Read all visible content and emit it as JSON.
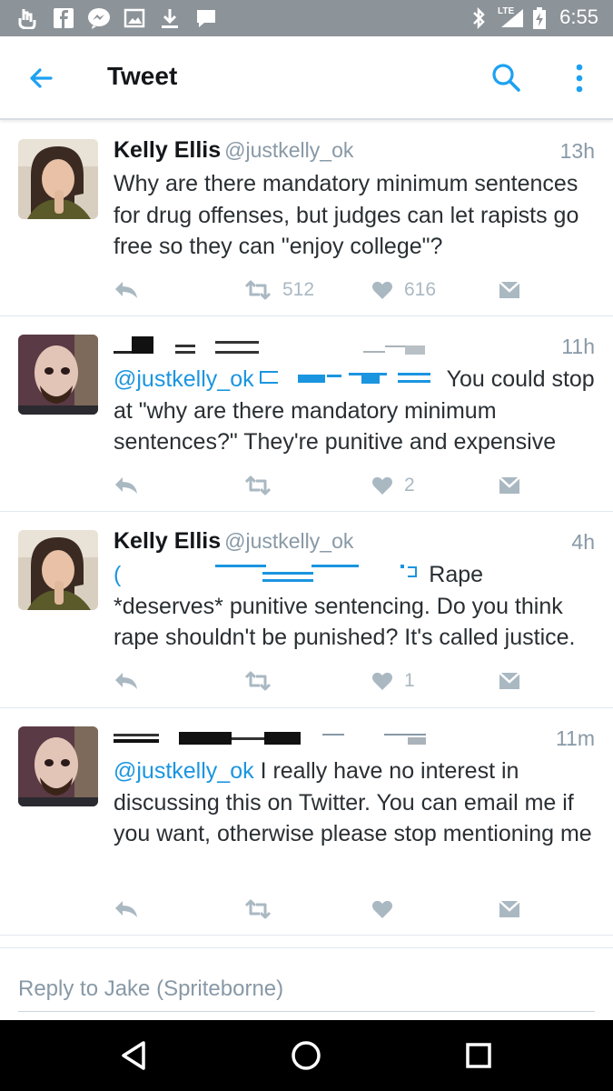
{
  "status_bar": {
    "time": "6:55",
    "network": "LTE",
    "icons": [
      "touch-icon",
      "facebook-icon",
      "messenger-icon",
      "gallery-icon",
      "download-icon",
      "chat-bubble-icon",
      "bluetooth-icon",
      "signal-icon",
      "battery-charging-icon"
    ]
  },
  "app_bar": {
    "title": "Tweet",
    "icons": [
      "back-arrow-icon",
      "search-icon",
      "more-vert-icon"
    ]
  },
  "tweets": [
    {
      "name": "Kelly Ellis",
      "handle": "@justkelly_ok",
      "time": "13h",
      "text": "Why are there mandatory minimum sentences for drug offenses, but judges can let rapists go free so they can \"enjoy college\"?",
      "retweets": "512",
      "likes": "616"
    },
    {
      "name": "",
      "handle": "",
      "time": "11h",
      "mention": "@justkelly_ok",
      "text": "You could stop at \"why are there mandatory minimum sentences?\" They're punitive and expensive",
      "retweets": "",
      "likes": "2"
    },
    {
      "name": "Kelly Ellis",
      "handle": "@justkelly_ok",
      "time": "4h",
      "mention_prefix": "(",
      "text_after": "Rape",
      "text": "*deserves* punitive sentencing. Do you think rape shouldn't be punished? It's called justice.",
      "retweets": "",
      "likes": "1"
    },
    {
      "name": "",
      "handle": "",
      "time": "11m",
      "mention": "@justkelly_ok",
      "text": "I really have no interest in discussing this on Twitter. You can email me if you want, otherwise please stop mentioning me",
      "retweets": "",
      "likes": ""
    }
  ],
  "reply": {
    "placeholder": "Reply to Jake (Spriteborne)"
  },
  "colors": {
    "status_bar": "#8c9399",
    "accent": "#1b95e0",
    "muted": "#8899a6",
    "text": "#292f33"
  }
}
